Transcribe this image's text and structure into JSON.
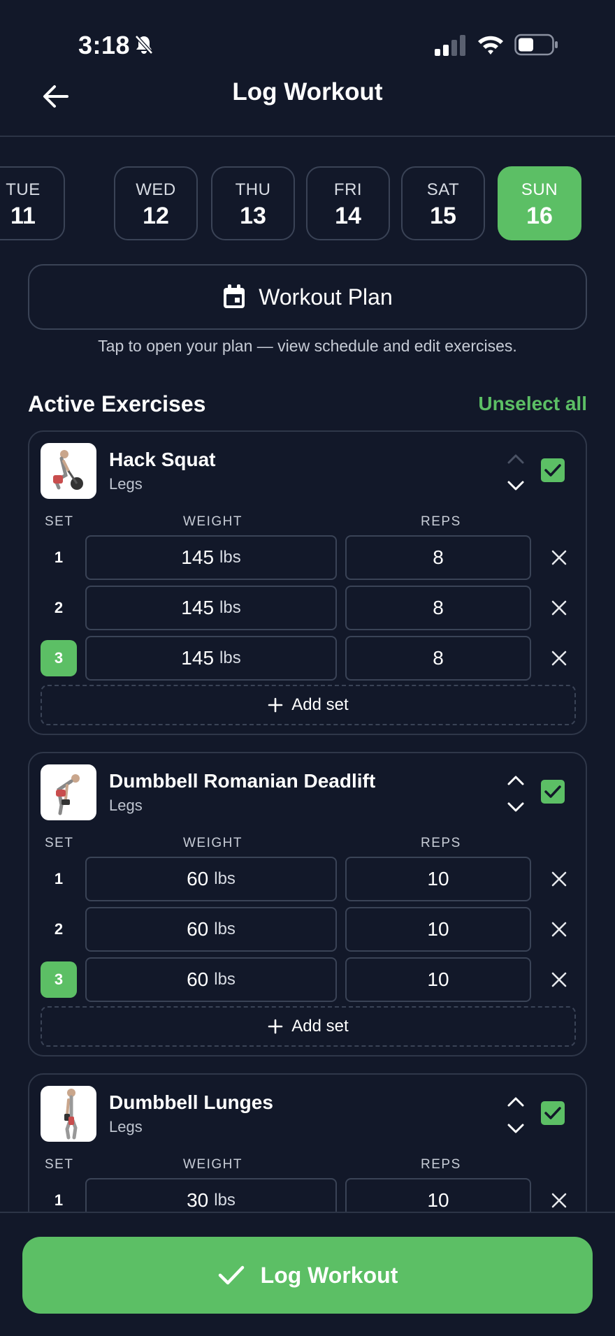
{
  "status": {
    "time": "3:18",
    "battery_level": 0.45
  },
  "header": {
    "title": "Log Workout"
  },
  "days": [
    {
      "name": "TUE",
      "date": "11",
      "selected": false
    },
    {
      "name": "WED",
      "date": "12",
      "selected": false
    },
    {
      "name": "THU",
      "date": "13",
      "selected": false
    },
    {
      "name": "FRI",
      "date": "14",
      "selected": false
    },
    {
      "name": "SAT",
      "date": "15",
      "selected": false
    },
    {
      "name": "SUN",
      "date": "16",
      "selected": true
    }
  ],
  "plan": {
    "label": "Workout Plan",
    "hint": "Tap to open your plan — view schedule and edit exercises."
  },
  "active": {
    "title": "Active Exercises",
    "unselect_label": "Unselect all"
  },
  "columns": {
    "set": "SET",
    "weight": "WEIGHT",
    "reps": "REPS"
  },
  "add_set_label": "Add set",
  "exercises": [
    {
      "name": "Hack Squat",
      "category": "Legs",
      "sets": [
        {
          "num": "1",
          "weight": "145",
          "unit": "lbs",
          "reps": "8",
          "active": false
        },
        {
          "num": "2",
          "weight": "145",
          "unit": "lbs",
          "reps": "8",
          "active": false
        },
        {
          "num": "3",
          "weight": "145",
          "unit": "lbs",
          "reps": "8",
          "active": true
        }
      ]
    },
    {
      "name": "Dumbbell Romanian Deadlift",
      "category": "Legs",
      "sets": [
        {
          "num": "1",
          "weight": "60",
          "unit": "lbs",
          "reps": "10",
          "active": false
        },
        {
          "num": "2",
          "weight": "60",
          "unit": "lbs",
          "reps": "10",
          "active": false
        },
        {
          "num": "3",
          "weight": "60",
          "unit": "lbs",
          "reps": "10",
          "active": true
        }
      ]
    },
    {
      "name": "Dumbbell Lunges",
      "category": "Legs",
      "sets": [
        {
          "num": "1",
          "weight": "30",
          "unit": "lbs",
          "reps": "10",
          "active": false
        }
      ]
    }
  ],
  "footer": {
    "log_label": "Log Workout"
  },
  "colors": {
    "background": "#121829",
    "accent": "#5cbf65",
    "border": "#3a4356"
  }
}
